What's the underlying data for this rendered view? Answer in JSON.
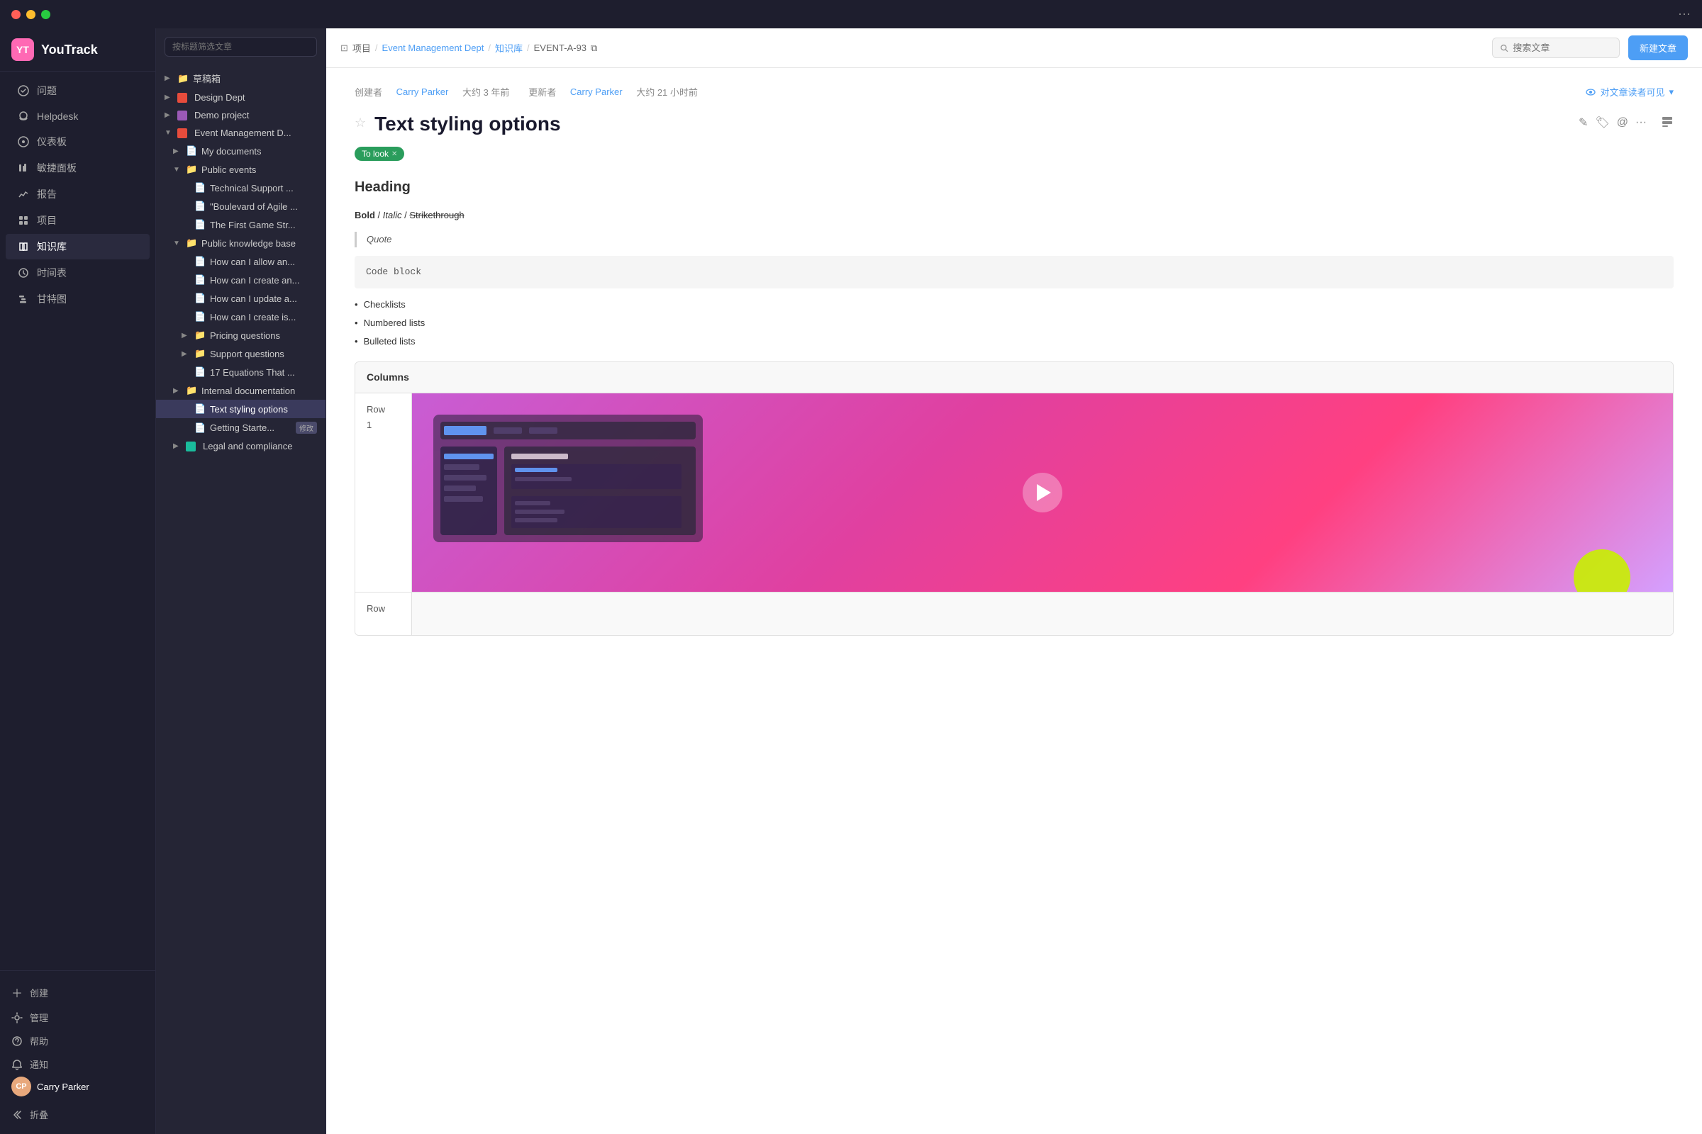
{
  "titlebar": {
    "buttons": [
      "close",
      "minimize",
      "maximize"
    ],
    "menu_icon": "⋯"
  },
  "left_nav": {
    "logo_text": "YouTrack",
    "logo_abbr": "YT",
    "items": [
      {
        "id": "issues",
        "label": "问题",
        "icon": "check-circle"
      },
      {
        "id": "helpdesk",
        "label": "Helpdesk",
        "icon": "headset"
      },
      {
        "id": "dashboard",
        "label": "仪表板",
        "icon": "dashboard"
      },
      {
        "id": "agile",
        "label": "敏捷面板",
        "icon": "agile"
      },
      {
        "id": "reports",
        "label": "报告",
        "icon": "chart"
      },
      {
        "id": "projects",
        "label": "项目",
        "icon": "grid"
      },
      {
        "id": "knowledge",
        "label": "知识库",
        "icon": "book"
      },
      {
        "id": "timeline",
        "label": "时间表",
        "icon": "time"
      },
      {
        "id": "gantt",
        "label": "甘特图",
        "icon": "gantt"
      }
    ],
    "bottom": {
      "create_label": "创建",
      "manage_label": "管理",
      "help_label": "帮助",
      "notify_label": "通知",
      "collapse_label": "折叠",
      "user_name": "Carry Parker"
    }
  },
  "file_sidebar": {
    "search_placeholder": "按标题筛选文章",
    "tree": [
      {
        "id": "drafts",
        "label": "草稿箱",
        "level": 0,
        "type": "folder",
        "expanded": false
      },
      {
        "id": "design-dept",
        "label": "Design Dept",
        "level": 0,
        "type": "folder",
        "color": "#e74c3c",
        "expanded": false
      },
      {
        "id": "demo-project",
        "label": "Demo project",
        "level": 0,
        "type": "folder",
        "color": "#9b59b6",
        "expanded": false
      },
      {
        "id": "event-mgmt",
        "label": "Event Management D...",
        "level": 0,
        "type": "folder",
        "color": "#e74c3c",
        "expanded": true
      },
      {
        "id": "my-docs",
        "label": "My documents",
        "level": 1,
        "type": "doc"
      },
      {
        "id": "public-events",
        "label": "Public events",
        "level": 1,
        "type": "folder",
        "expanded": true
      },
      {
        "id": "tech-support",
        "label": "Technical Support ...",
        "level": 2,
        "type": "doc"
      },
      {
        "id": "boulevard",
        "label": "\"Boulevard of Agile ...",
        "level": 2,
        "type": "doc"
      },
      {
        "id": "first-game",
        "label": "The First Game Str...",
        "level": 2,
        "type": "doc"
      },
      {
        "id": "public-kb",
        "label": "Public knowledge base",
        "level": 1,
        "type": "folder",
        "expanded": true
      },
      {
        "id": "how-allow",
        "label": "How can I allow an...",
        "level": 2,
        "type": "doc"
      },
      {
        "id": "how-create",
        "label": "How can I create an...",
        "level": 2,
        "type": "doc"
      },
      {
        "id": "how-update",
        "label": "How can I update a...",
        "level": 2,
        "type": "doc"
      },
      {
        "id": "how-create-is",
        "label": "How can I create is...",
        "level": 2,
        "type": "doc"
      },
      {
        "id": "pricing-q",
        "label": "Pricing questions",
        "level": 2,
        "type": "folder",
        "expanded": false
      },
      {
        "id": "support-q",
        "label": "Support questions",
        "level": 2,
        "type": "folder",
        "expanded": false
      },
      {
        "id": "17-equations",
        "label": "17 Equations That ...",
        "level": 2,
        "type": "doc"
      },
      {
        "id": "internal-docs",
        "label": "Internal documentation",
        "level": 1,
        "type": "folder",
        "expanded": false
      },
      {
        "id": "text-styling",
        "label": "Text styling options",
        "level": 2,
        "type": "doc",
        "active": true
      },
      {
        "id": "getting-started",
        "label": "Getting Starte...",
        "level": 2,
        "type": "doc",
        "badge": "修改"
      },
      {
        "id": "legal",
        "label": "Legal and compliance",
        "level": 1,
        "type": "folder",
        "expanded": false,
        "color": "#1abc9c"
      }
    ]
  },
  "header": {
    "breadcrumb": {
      "project": "项目",
      "dept": "Event Management Dept",
      "kb": "知识库",
      "article_id": "EVENT-A-93",
      "copy_icon": "⧉"
    },
    "search_placeholder": "搜索文章",
    "new_article_label": "新建文章"
  },
  "article": {
    "meta": {
      "created_by": "创建者",
      "creator": "Carry Parker",
      "created_time": "大约 3 年前",
      "updated_by": "更新者",
      "updater": "Carry Parker",
      "updated_time": "大约 21 小时前",
      "visibility_label": "对文章读者可见",
      "visibility_icon": "▾"
    },
    "title": "Text styling options",
    "tag": "To look",
    "body": {
      "heading": "Heading",
      "text_line": "Bold",
      "text_separator": "/",
      "text_italic": "Italic",
      "text_strike": "Strikethrough",
      "quote": "Quote",
      "code_block": "Code block",
      "list_items": [
        {
          "label": "Checklists"
        },
        {
          "label": "Numbered lists"
        },
        {
          "label": "Bulleted lists"
        }
      ],
      "columns_header": "Columns",
      "row1_label": "Row\n1",
      "row2_label": "Row"
    }
  }
}
